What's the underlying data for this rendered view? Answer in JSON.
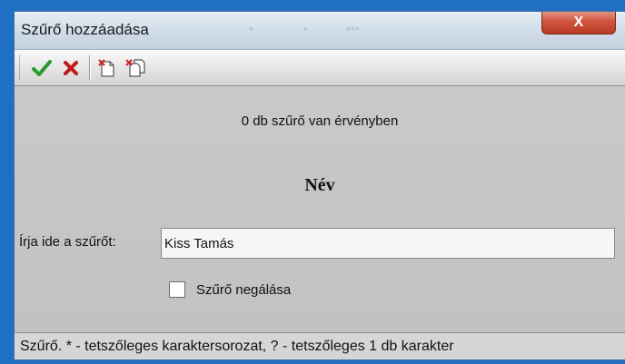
{
  "window": {
    "title": "Szűrő hozzáadása",
    "close_label": "X"
  },
  "toolbar": {
    "ok_icon": "checkmark-icon",
    "cancel_icon": "cross-icon",
    "new_icon": "new-document-icon",
    "copy_icon": "copy-document-icon"
  },
  "content": {
    "filter_count_text": "0 db szűrő van érvényben",
    "field_title": "Név",
    "filter_label": "Írja ide a szűrőt:",
    "filter_value": "Kiss Tamás",
    "negate_label": "Szűrő negálása",
    "negate_checked": false
  },
  "statusbar": {
    "text": "Szűrő. * - tetszőleges karaktersorozat, ? - tetszőleges 1 db karakter"
  },
  "colors": {
    "accent_green": "#2a9a2a",
    "accent_red": "#c01818",
    "desktop_blue": "#1f6fc4"
  }
}
